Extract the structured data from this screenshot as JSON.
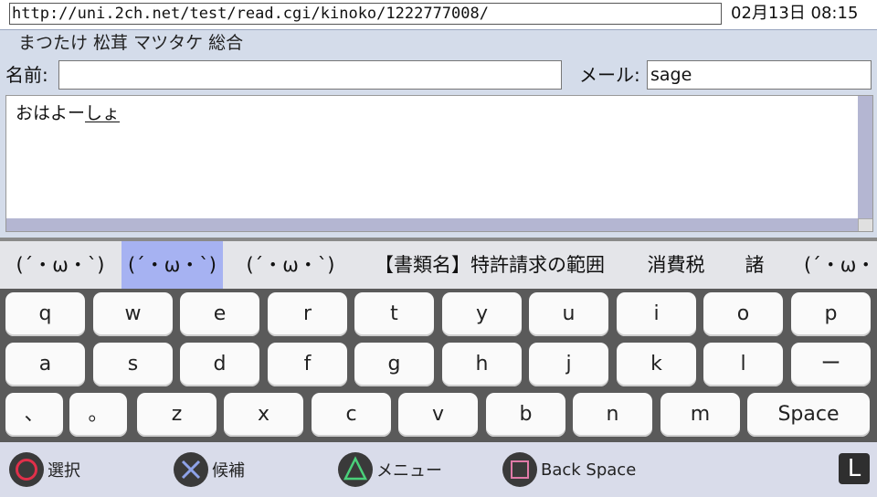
{
  "header": {
    "url": "http://uni.2ch.net/test/read.cgi/kinoko/1222777008/",
    "clock": "02月13日 08:15"
  },
  "thread": {
    "title": "まつたけ 松茸 マツタケ 総合"
  },
  "form": {
    "name_label": "名前:",
    "name_value": "",
    "mail_label": "メール:",
    "mail_value": "sage",
    "message_confirmed": "おはよー",
    "message_composing": "しょ"
  },
  "candidates": [
    {
      "text": "(´・ω・`)",
      "selected": false
    },
    {
      "text": "(´・ω・`)",
      "selected": true
    },
    {
      "text": "(´・ω・`)",
      "selected": false
    },
    {
      "text": "【書類名】特許請求の範囲",
      "selected": false
    },
    {
      "text": "消費税",
      "selected": false
    },
    {
      "text": "諸",
      "selected": false
    },
    {
      "text": "(´・ω・",
      "selected": false
    }
  ],
  "keyboard": {
    "row1": [
      "q",
      "w",
      "e",
      "r",
      "t",
      "y",
      "u",
      "i",
      "o",
      "p"
    ],
    "row2": [
      "a",
      "s",
      "d",
      "f",
      "g",
      "h",
      "j",
      "k",
      "l",
      "ー"
    ],
    "row3": [
      "、",
      "。",
      "z",
      "x",
      "c",
      "v",
      "b",
      "n",
      "m",
      "Space"
    ]
  },
  "guide": {
    "circle_label": "選択",
    "cross_label": "候補",
    "triangle_label": "メニュー",
    "square_label": "Back Space",
    "l_label": "L"
  },
  "colors": {
    "panel": "#d4dcea",
    "candidate_selected": "#a6b2f2",
    "keyboard_bg": "#5a5a5a",
    "circle": "#e0304a",
    "cross": "#8ea2e8",
    "triangle": "#4ad07a",
    "square": "#e07aa8"
  }
}
